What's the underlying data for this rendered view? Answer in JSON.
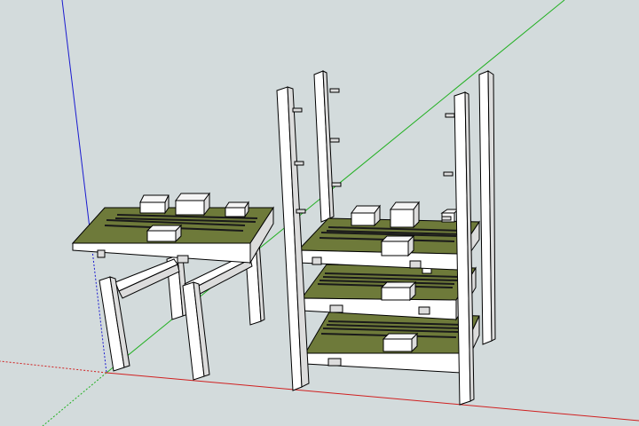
{
  "viewport": {
    "background": "#d3dbdc",
    "caption": ""
  },
  "axes": {
    "x_color": "#d02020",
    "y_color": "#22b022",
    "z_color": "#1a1ad0"
  },
  "colors": {
    "frame_face": "#ffffff",
    "frame_side": "#dcdcdc",
    "frame_edge": "#000000",
    "board_top": "#6e7a3a",
    "board_dark": "#5a652c",
    "track": "#2a2a2a",
    "block_face": "#f2f2f2"
  },
  "scene": {
    "objects": [
      {
        "name": "single-level-table",
        "kind": "table"
      },
      {
        "name": "three-level-shelf",
        "kind": "shelf",
        "levels": 3
      }
    ]
  }
}
